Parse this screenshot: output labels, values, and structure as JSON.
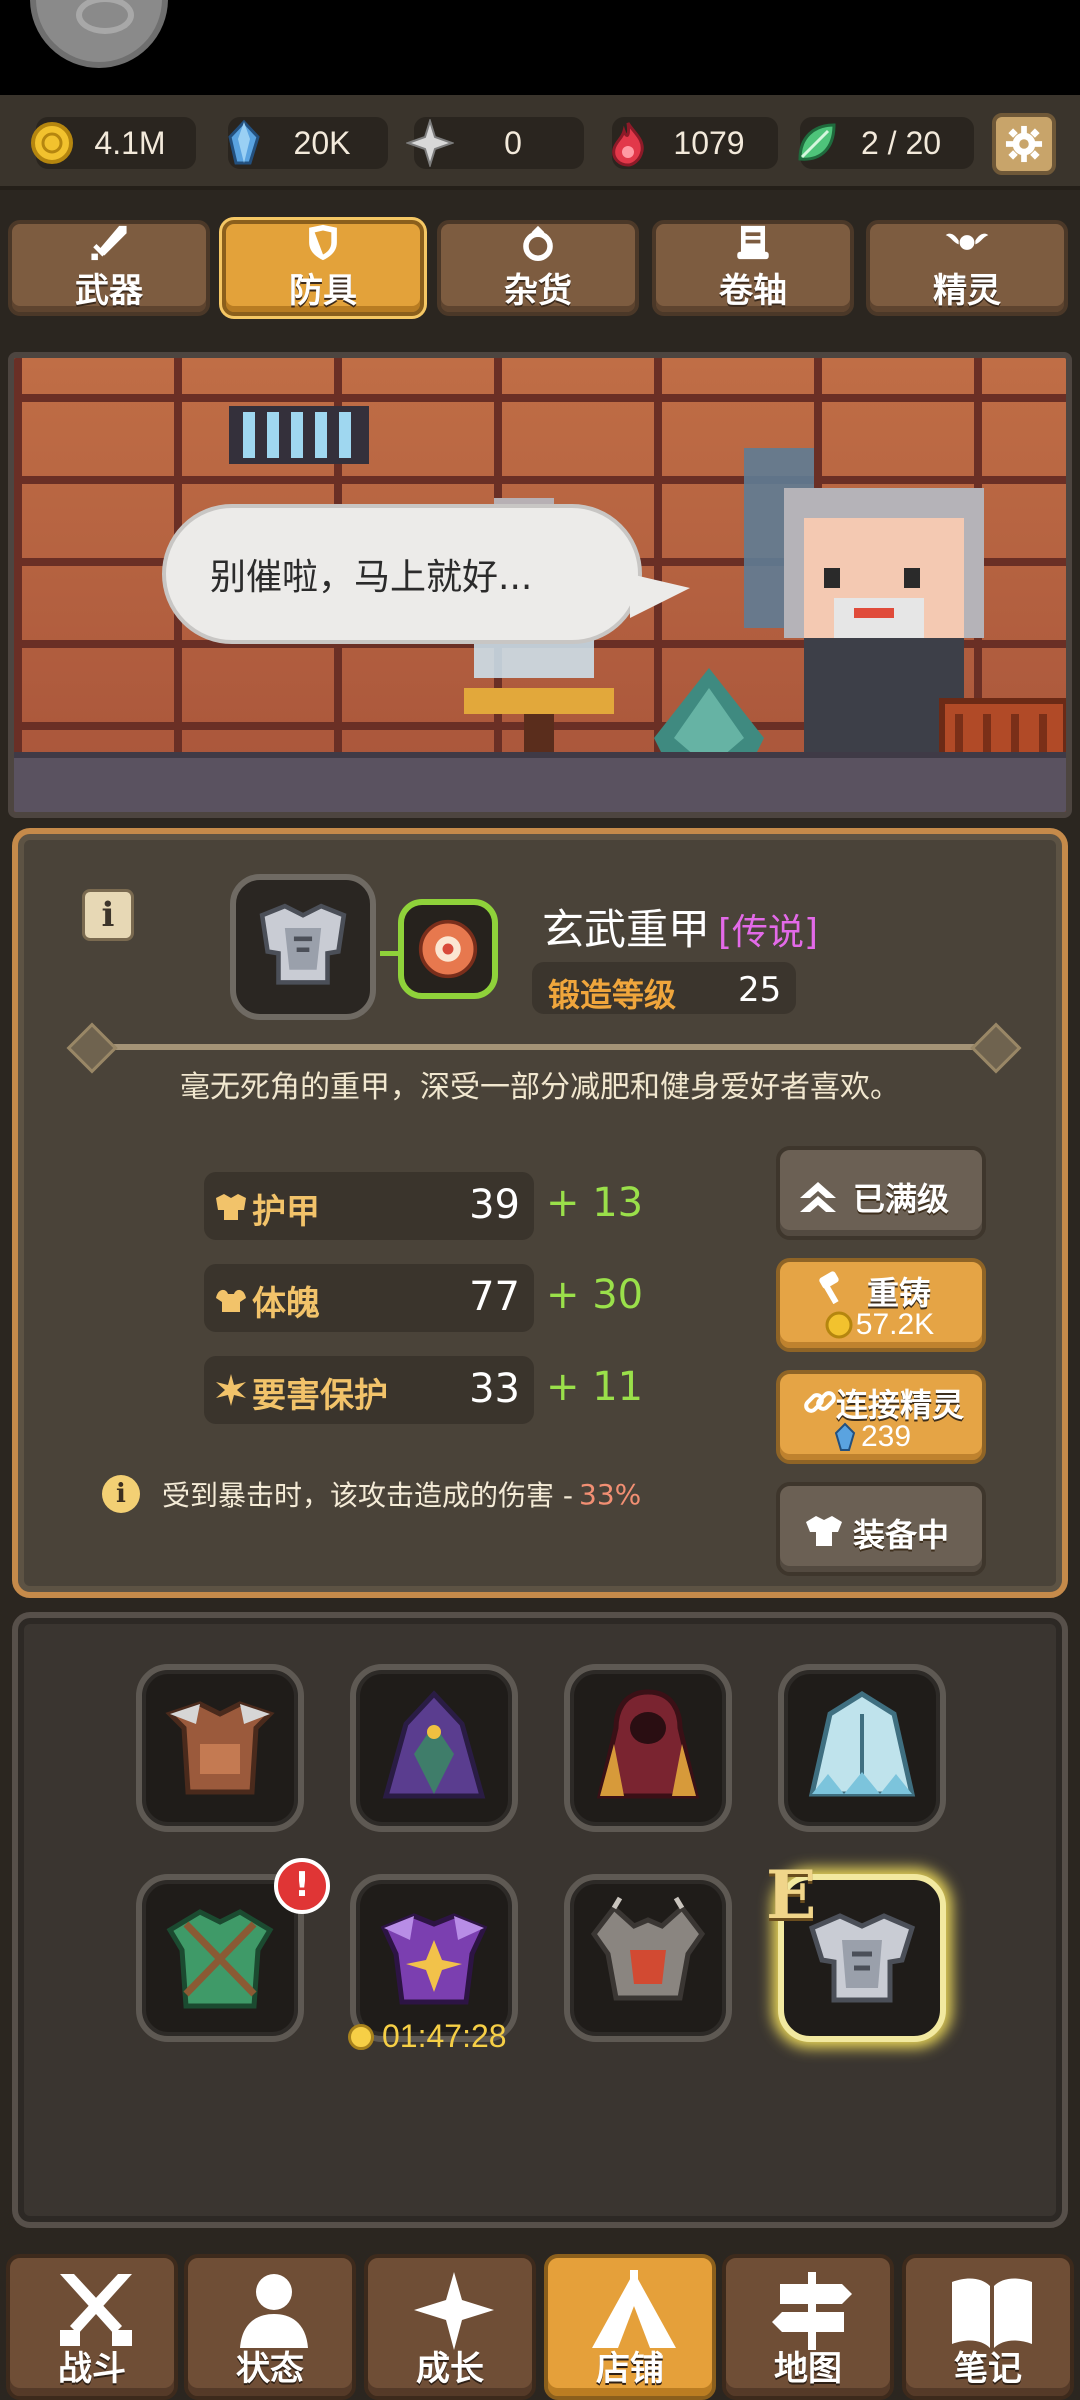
{
  "resources": [
    {
      "name": "gold",
      "value": "4.1M"
    },
    {
      "name": "gem",
      "value": "20K"
    },
    {
      "name": "star",
      "value": "0"
    },
    {
      "name": "flame",
      "value": "1079"
    },
    {
      "name": "spirit",
      "value": "2 / 20"
    }
  ],
  "tabs": [
    {
      "label": "武器",
      "icon": "sword-icon"
    },
    {
      "label": "防具",
      "icon": "shield-icon",
      "active": true
    },
    {
      "label": "杂货",
      "icon": "ring-icon"
    },
    {
      "label": "卷轴",
      "icon": "scroll-icon"
    },
    {
      "label": "精灵",
      "icon": "spirit-icon"
    }
  ],
  "scene": {
    "speech": "别催啦，马上就好..."
  },
  "item": {
    "name": "玄武重甲",
    "rarity": "[传说]",
    "forge_label": "锻造等级",
    "forge_level": "25",
    "description": "毫无死角的重甲，深受一部分减肥和健身爱好者喜欢。",
    "stats": [
      {
        "name": "护甲",
        "base": "39",
        "bonus": "+ 13"
      },
      {
        "name": "体魄",
        "base": "77",
        "bonus": "+ 30"
      },
      {
        "name": "要害保护",
        "base": "33",
        "bonus": "+ 11"
      }
    ],
    "note_text": "受到暴击时，该攻击造成的伤害 -",
    "note_pct": "33%"
  },
  "actions": {
    "maxed": "已满级",
    "reforge": "重铸",
    "reforge_cost": "57.2K",
    "link_spirit": "连接精灵",
    "link_cost": "239",
    "equipped": "装备中"
  },
  "inventory": {
    "alert": "!",
    "equipped_mark": "E",
    "timer": "01:47:28"
  },
  "nav": [
    {
      "label": "战斗",
      "icon": "swords-icon"
    },
    {
      "label": "状态",
      "icon": "person-icon"
    },
    {
      "label": "成长",
      "icon": "sparkle-icon"
    },
    {
      "label": "店铺",
      "icon": "tent-icon",
      "active": true
    },
    {
      "label": "地图",
      "icon": "signpost-icon"
    },
    {
      "label": "笔记",
      "icon": "book-icon"
    }
  ],
  "colors": {
    "accent": "#e3a23a",
    "legendary": "#e36ae8",
    "bonus_green": "#9ae04a",
    "forge_orange": "#f0a63c"
  }
}
